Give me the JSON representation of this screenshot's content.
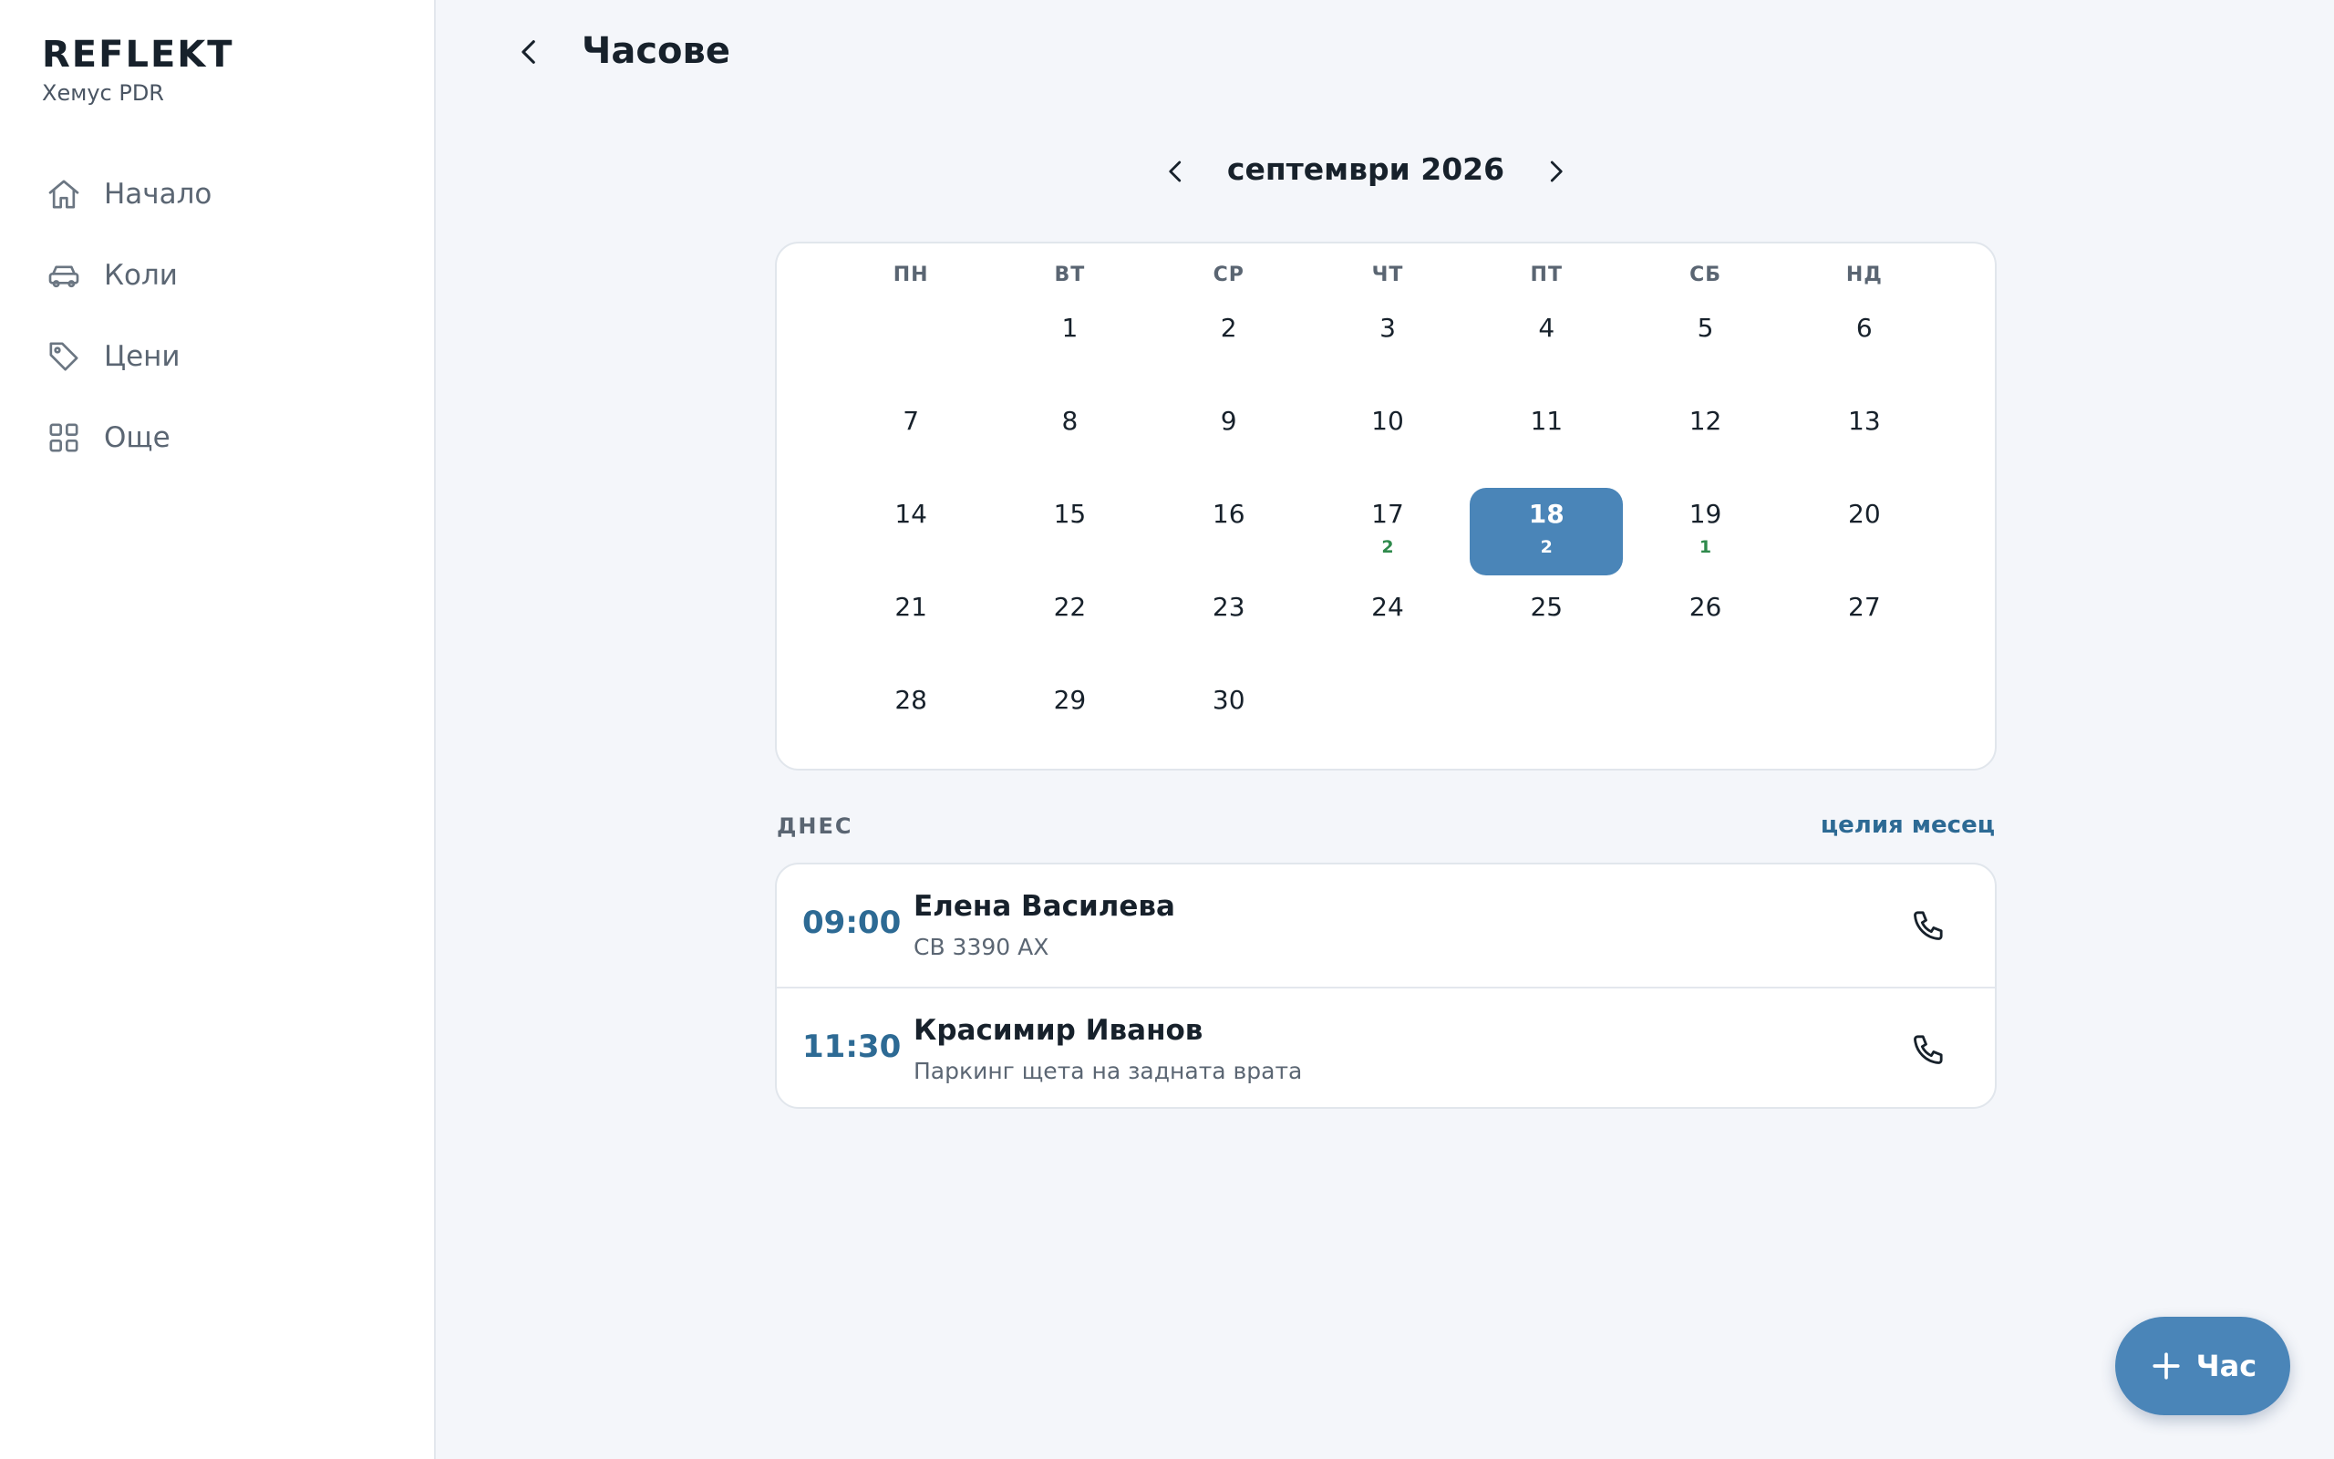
{
  "app": {
    "logo": "REFLEKT",
    "subtitle": "Хемус PDR"
  },
  "sidebar": {
    "items": [
      {
        "label": "Начало",
        "icon": "home-icon"
      },
      {
        "label": "Коли",
        "icon": "car-icon"
      },
      {
        "label": "Цени",
        "icon": "tag-icon"
      },
      {
        "label": "Още",
        "icon": "grid-icon"
      }
    ]
  },
  "header": {
    "title": "Часове"
  },
  "calendar": {
    "month_label": "септември 2026",
    "weekdays": [
      "ПН",
      "ВТ",
      "СР",
      "ЧТ",
      "ПТ",
      "СБ",
      "НД"
    ],
    "weeks": [
      [
        {
          "d": ""
        },
        {
          "d": "1"
        },
        {
          "d": "2"
        },
        {
          "d": "3"
        },
        {
          "d": "4"
        },
        {
          "d": "5"
        },
        {
          "d": "6"
        }
      ],
      [
        {
          "d": "7"
        },
        {
          "d": "8"
        },
        {
          "d": "9"
        },
        {
          "d": "10"
        },
        {
          "d": "11"
        },
        {
          "d": "12"
        },
        {
          "d": "13"
        }
      ],
      [
        {
          "d": "14"
        },
        {
          "d": "15"
        },
        {
          "d": "16"
        },
        {
          "d": "17",
          "count": "2"
        },
        {
          "d": "18",
          "count": "2",
          "selected": true
        },
        {
          "d": "19",
          "count": "1"
        },
        {
          "d": "20"
        }
      ],
      [
        {
          "d": "21"
        },
        {
          "d": "22"
        },
        {
          "d": "23"
        },
        {
          "d": "24"
        },
        {
          "d": "25"
        },
        {
          "d": "26"
        },
        {
          "d": "27"
        }
      ],
      [
        {
          "d": "28"
        },
        {
          "d": "29"
        },
        {
          "d": "30"
        },
        {
          "d": ""
        },
        {
          "d": ""
        },
        {
          "d": ""
        },
        {
          "d": ""
        }
      ]
    ]
  },
  "today": {
    "label": "ДНЕС",
    "month_link": "целия месец"
  },
  "appointments": [
    {
      "time": "09:00",
      "name": "Елена Василева",
      "detail": "СВ 3390 АХ"
    },
    {
      "time": "11:30",
      "name": "Красимир Иванов",
      "detail": "Паркинг щета на задната врата"
    }
  ],
  "fab": {
    "label": "Час"
  },
  "colors": {
    "accent": "#4a85b8",
    "link": "#2d6a94",
    "count": "#2f8a4c"
  }
}
